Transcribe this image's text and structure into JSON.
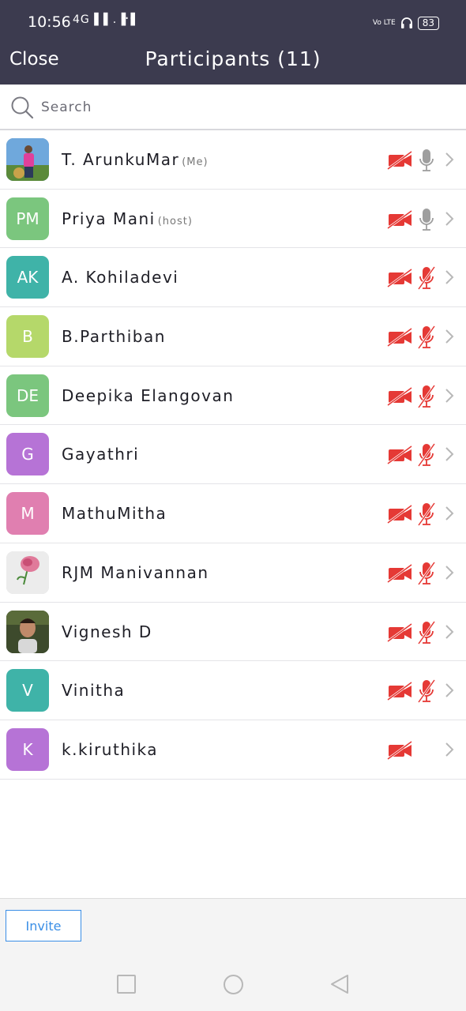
{
  "status_bar": {
    "time": "10:56",
    "signal": "4G▐▐ .▐▐",
    "dots": "···",
    "volte": "Vo LTE",
    "battery": "83"
  },
  "header": {
    "close_label": "Close",
    "title": "Participants (11)"
  },
  "search": {
    "placeholder": "Search"
  },
  "colors": {
    "header_bg": "#3c3b4f",
    "muted_red": "#e53935",
    "mic_grey": "#9e9e9e",
    "invite_blue": "#3a8ee6"
  },
  "participants": [
    {
      "name": "T. ArunkuMar",
      "tag": "(Me)",
      "initials": "",
      "avatar_type": "photo-man-outdoor",
      "avatar_color": "#4a7fb0",
      "video_off": true,
      "mic": "on"
    },
    {
      "name": "Priya Mani",
      "tag": "(host)",
      "initials": "PM",
      "avatar_type": "initials",
      "avatar_color": "#7bc67e",
      "video_off": true,
      "mic": "on"
    },
    {
      "name": "A. Kohiladevi",
      "tag": "",
      "initials": "AK",
      "avatar_type": "initials",
      "avatar_color": "#3fb3a8",
      "video_off": true,
      "mic": "muted"
    },
    {
      "name": "B.Parthiban",
      "tag": "",
      "initials": "B",
      "avatar_type": "initials",
      "avatar_color": "#b5d86a",
      "video_off": true,
      "mic": "muted"
    },
    {
      "name": "Deepika Elangovan",
      "tag": "",
      "initials": "DE",
      "avatar_type": "initials",
      "avatar_color": "#7bc67e",
      "video_off": true,
      "mic": "muted"
    },
    {
      "name": "Gayathri",
      "tag": "",
      "initials": "G",
      "avatar_type": "initials",
      "avatar_color": "#b673d6",
      "video_off": true,
      "mic": "muted"
    },
    {
      "name": "MathuMitha",
      "tag": "",
      "initials": "M",
      "avatar_type": "initials",
      "avatar_color": "#e07fb0",
      "video_off": true,
      "mic": "muted"
    },
    {
      "name": "RJM Manivannan",
      "tag": "",
      "initials": "",
      "avatar_type": "photo-flower",
      "avatar_color": "#d9d9d9",
      "video_off": true,
      "mic": "muted"
    },
    {
      "name": "Vignesh D",
      "tag": "",
      "initials": "",
      "avatar_type": "photo-man-dark",
      "avatar_color": "#3a4a2a",
      "video_off": true,
      "mic": "muted"
    },
    {
      "name": "Vinitha",
      "tag": "",
      "initials": "V",
      "avatar_type": "initials",
      "avatar_color": "#3fb3a8",
      "video_off": true,
      "mic": "muted"
    },
    {
      "name": "k.kiruthika",
      "tag": "",
      "initials": "K",
      "avatar_type": "initials",
      "avatar_color": "#b673d6",
      "video_off": true,
      "mic": "none"
    }
  ],
  "footer": {
    "invite_label": "Invite"
  }
}
